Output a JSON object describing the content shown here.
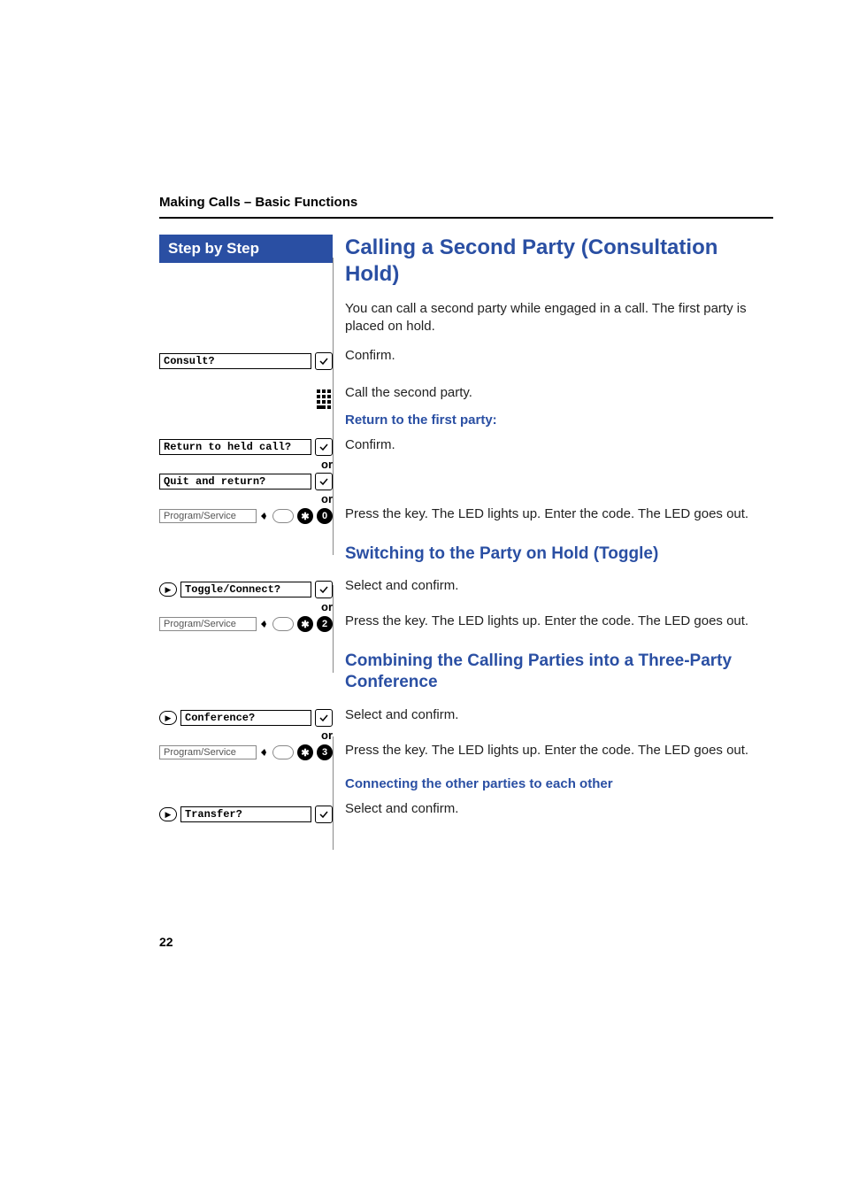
{
  "header": {
    "section": "Making Calls – Basic Functions"
  },
  "sidebar": {
    "heading": "Step by Step"
  },
  "left": {
    "consult": "Consult?",
    "return_held": "Return to held call?",
    "quit_return": "Quit and return?",
    "program_service": "Program/Service",
    "toggle_connect": "Toggle/Connect?",
    "conference": "Conference?",
    "transfer": "Transfer?",
    "or": "or",
    "code0": "0",
    "code2": "2",
    "code3": "3"
  },
  "main": {
    "title": "Calling a Second Party (Consultation Hold)",
    "intro": "You can call a second party while engaged in a call. The first party is placed on hold.",
    "confirm": "Confirm.",
    "call_second": "Call the second party.",
    "return_first": "Return to the first party:",
    "press_key": "Press the key. The LED lights up. Enter the code. The LED goes out.",
    "sub_toggle": "Switching to the Party on Hold (Toggle)",
    "select_confirm": "Select and confirm.",
    "sub_conf": "Combining the Calling Parties into a Three-Party Conference",
    "connecting": "Connecting the other parties to each other"
  },
  "page_number": "22"
}
